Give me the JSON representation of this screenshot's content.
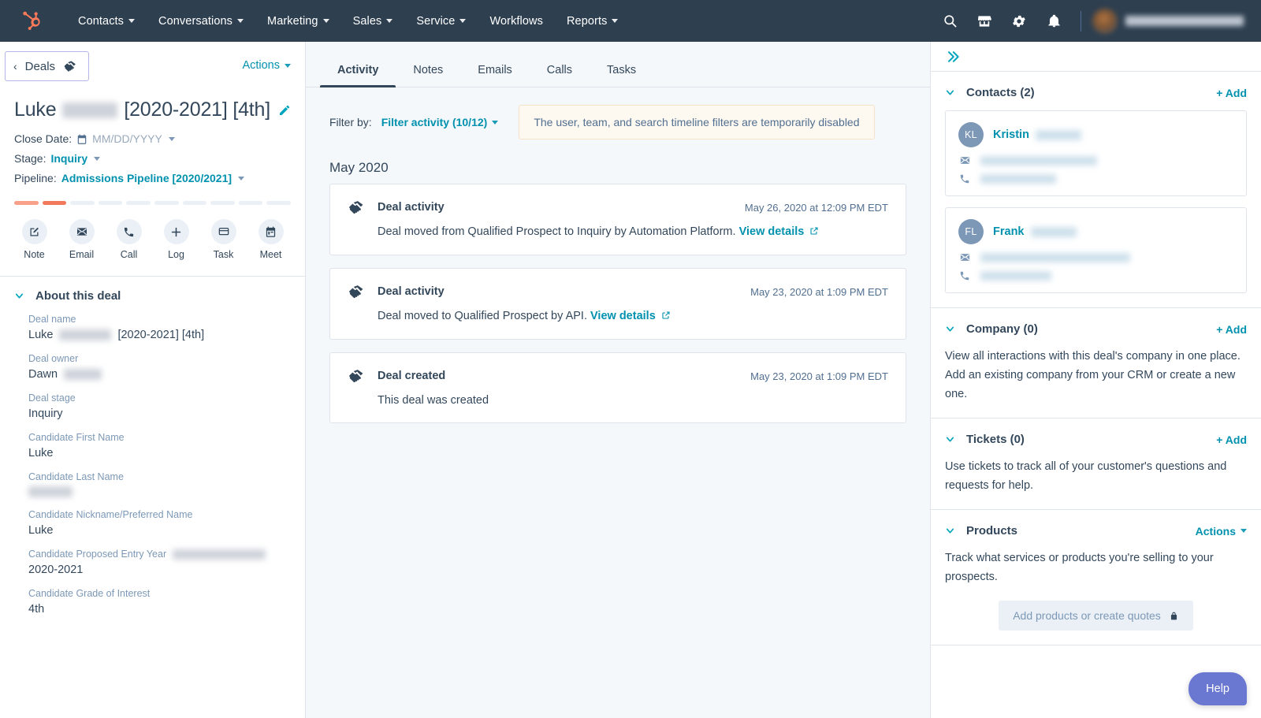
{
  "topnav": {
    "logo_icon": "hubspot-sprocket-logo",
    "items": [
      {
        "label": "Contacts",
        "has_caret": true
      },
      {
        "label": "Conversations",
        "has_caret": true
      },
      {
        "label": "Marketing",
        "has_caret": true
      },
      {
        "label": "Sales",
        "has_caret": true
      },
      {
        "label": "Service",
        "has_caret": true
      },
      {
        "label": "Workflows",
        "has_caret": false
      },
      {
        "label": "Reports",
        "has_caret": true
      }
    ],
    "right_icons": [
      "search-icon",
      "marketplace-icon",
      "settings-gear-icon",
      "notifications-bell-icon"
    ],
    "background": "#2e3f50"
  },
  "left_panel": {
    "back_button": {
      "label": "Deals",
      "icon": "handshake-icon",
      "chevron": "‹"
    },
    "actions_label": "Actions",
    "deal_title": {
      "first": "Luke",
      "redacted_name": true,
      "suffix": "[2020-2021] [4th]"
    },
    "edit_icon": "pencil-icon",
    "close_date": {
      "label": "Close Date:",
      "icon": "calendar-icon",
      "placeholder": "MM/DD/YYYY"
    },
    "stage": {
      "label": "Stage:",
      "value": "Inquiry"
    },
    "pipeline": {
      "label": "Pipeline:",
      "value": "Admissions Pipeline [2020/2021]"
    },
    "stage_bar": {
      "total": 10,
      "completed": 2,
      "active_colors": [
        "#f8a08a",
        "#f2795e"
      ],
      "inactive_color": "#eaf0f6"
    },
    "quick_actions": [
      {
        "label": "Note",
        "icon": "note-pencil-icon"
      },
      {
        "label": "Email",
        "icon": "envelope-icon"
      },
      {
        "label": "Call",
        "icon": "phone-icon"
      },
      {
        "label": "Log",
        "icon": "plus-icon"
      },
      {
        "label": "Task",
        "icon": "task-card-icon"
      },
      {
        "label": "Meet",
        "icon": "calendar-meet-icon"
      }
    ],
    "about": {
      "title": "About this deal",
      "properties": [
        {
          "label": "Deal name",
          "value": "Luke",
          "value_suffix": "[2020-2021] [4th]",
          "redacted_value": true
        },
        {
          "label": "Deal owner",
          "value": "Dawn",
          "redacted_value": true
        },
        {
          "label": "Deal stage",
          "value": "Inquiry",
          "redacted_value": false
        },
        {
          "label": "Candidate First Name",
          "value": "Luke",
          "redacted_value": false
        },
        {
          "label": "Candidate Last Name",
          "value": "",
          "redacted_value": true
        },
        {
          "label": "Candidate Nickname/Preferred Name",
          "value": "Luke",
          "redacted_value": false
        },
        {
          "label": "Candidate Proposed Entry Year",
          "value": "2020-2021",
          "redacted_label_tail": true
        },
        {
          "label": "Candidate Grade of Interest",
          "value": "4th",
          "redacted_value": false
        }
      ]
    }
  },
  "center_panel": {
    "tabs": [
      {
        "label": "Activity",
        "active": true
      },
      {
        "label": "Notes",
        "active": false
      },
      {
        "label": "Emails",
        "active": false
      },
      {
        "label": "Calls",
        "active": false
      },
      {
        "label": "Tasks",
        "active": false
      }
    ],
    "filter_by_label": "Filter by:",
    "filter_activity_label": "Filter activity (10/12)",
    "banner_text": "The user, team, and search timeline filters are temporarily disabled",
    "month_heading": "May 2020",
    "activities": [
      {
        "icon": "handshake-icon",
        "title": "Deal activity",
        "timestamp": "May 26, 2020 at 12:09 PM EDT",
        "body_text": "Deal moved from Qualified Prospect to Inquiry by Automation Platform.",
        "link_text": "View details",
        "has_link": true
      },
      {
        "icon": "handshake-icon",
        "title": "Deal activity",
        "timestamp": "May 23, 2020 at 1:09 PM EDT",
        "body_text": "Deal moved to Qualified Prospect by API.",
        "link_text": "View details",
        "has_link": true
      },
      {
        "icon": "handshake-icon",
        "title": "Deal created",
        "timestamp": "May 23, 2020 at 1:09 PM EDT",
        "body_text": "This deal was created",
        "link_text": "",
        "has_link": false
      }
    ]
  },
  "right_panel": {
    "collapse_icon": "double-chevron-right-icon",
    "contacts": {
      "title": "Contacts (2)",
      "add_label": "+ Add",
      "items": [
        {
          "initials": "KL",
          "name": "Kristin",
          "redacted_last": true,
          "email_redacted": true,
          "phone_redacted": true
        },
        {
          "initials": "FL",
          "name": "Frank",
          "redacted_last": true,
          "email_redacted": true,
          "phone_redacted": true
        }
      ]
    },
    "company": {
      "title": "Company (0)",
      "add_label": "+ Add",
      "text": "View all interactions with this deal's company in one place. Add an existing company from your CRM or create a new one."
    },
    "tickets": {
      "title": "Tickets (0)",
      "add_label": "+ Add",
      "text": "Use tickets to track all of your customer's questions and requests for help."
    },
    "products": {
      "title": "Products",
      "actions_label": "Actions",
      "text": "Track what services or products you're selling to your prospects.",
      "button_label": "Add products or create quotes",
      "button_icon": "lock-icon"
    },
    "help_button": {
      "label": "Help",
      "color": "#6a78d1"
    }
  }
}
